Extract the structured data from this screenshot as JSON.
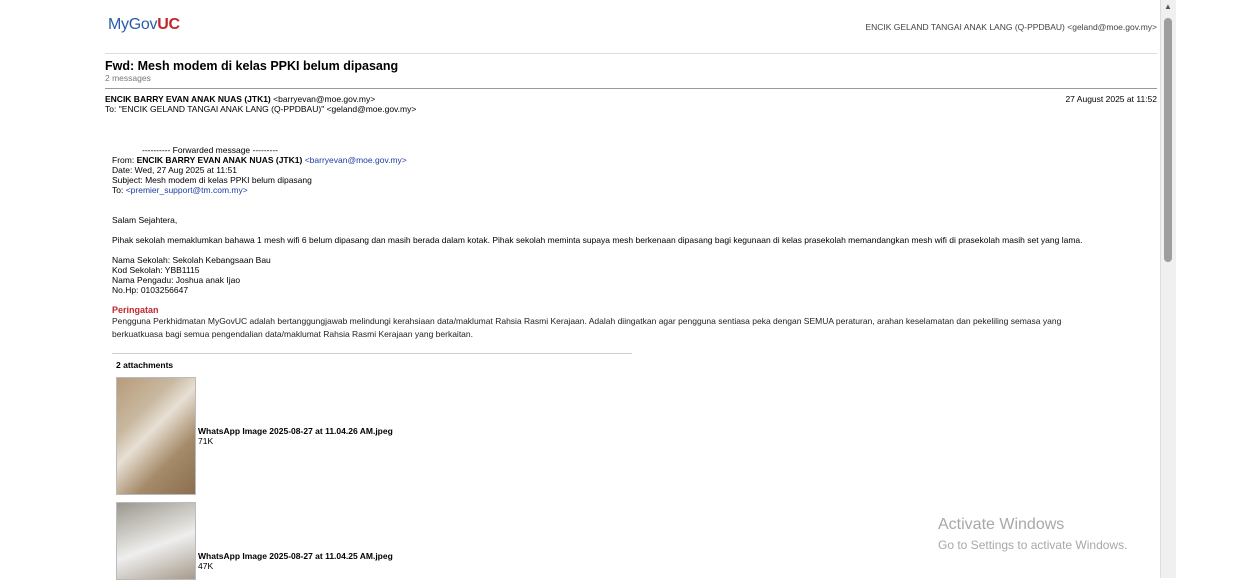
{
  "logo": {
    "my": "MyGov",
    "uc": "UC"
  },
  "user": "ENCIK GELAND TANGAI ANAK LANG (Q-PPDBAU) <geland@moe.gov.my>",
  "thread": {
    "subject": "Fwd: Mesh modem di kelas PPKI belum dipasang",
    "count": "2 messages"
  },
  "message": {
    "from_name": "ENCIK BARRY EVAN ANAK NUAS (JTK1)",
    "from_email": "<barryevan@moe.gov.my>",
    "to": "To: \"ENCIK GELAND TANGAI ANAK LANG (Q-PPDBAU)\" <geland@moe.gov.my>",
    "date": "27 August 2025 at 11:52"
  },
  "forward": {
    "header": "---------- Forwarded message ---------",
    "from_label": "From: ",
    "from_name": "ENCIK BARRY EVAN ANAK NUAS (JTK1)",
    "from_email": "<barryevan@moe.gov.my>",
    "date": "Date: Wed, 27 Aug 2025 at 11:51",
    "subject": "Subject: Mesh modem di kelas PPKI belum dipasang",
    "to_label": "To: ",
    "to_email": "<premier_support@tm.com.my>"
  },
  "body": {
    "greeting": "Salam Sejahtera,",
    "paragraph": "Pihak sekolah memaklumkan bahawa 1 mesh wifi 6 belum dipasang dan masih berada dalam kotak. Pihak sekolah meminta supaya mesh berkenaan dipasang bagi kegunaan di kelas prasekolah memandangkan mesh wifi di prasekolah masih set yang lama.",
    "school_name": "Nama Sekolah: Sekolah Kebangsaan Bau",
    "school_code": "Kod Sekolah: YBB1115",
    "manager": "Nama Pengadu: Joshua anak Ijao",
    "phone": "No.Hp: 0103256647"
  },
  "warning": {
    "title": "Peringatan",
    "text": "Pengguna Perkhidmatan MyGovUC adalah bertanggungjawab melindungi kerahsiaan data/maklumat Rahsia Rasmi Kerajaan. Adalah diingatkan agar pengguna sentiasa peka dengan SEMUA peraturan, arahan keselamatan dan pekeliling semasa yang berkuatkuasa bagi semua pengendalian data/maklumat Rahsia Rasmi Kerajaan yang berkaitan."
  },
  "attachments": {
    "header": "2 attachments",
    "items": [
      {
        "name": "WhatsApp Image 2025-08-27 at 11.04.26 AM.jpeg",
        "size": "71K"
      },
      {
        "name": "WhatsApp Image 2025-08-27 at 11.04.25 AM.jpeg",
        "size": "47K"
      }
    ]
  },
  "watermark": {
    "line1": "Activate Windows",
    "line2": "Go to Settings to activate Windows."
  }
}
